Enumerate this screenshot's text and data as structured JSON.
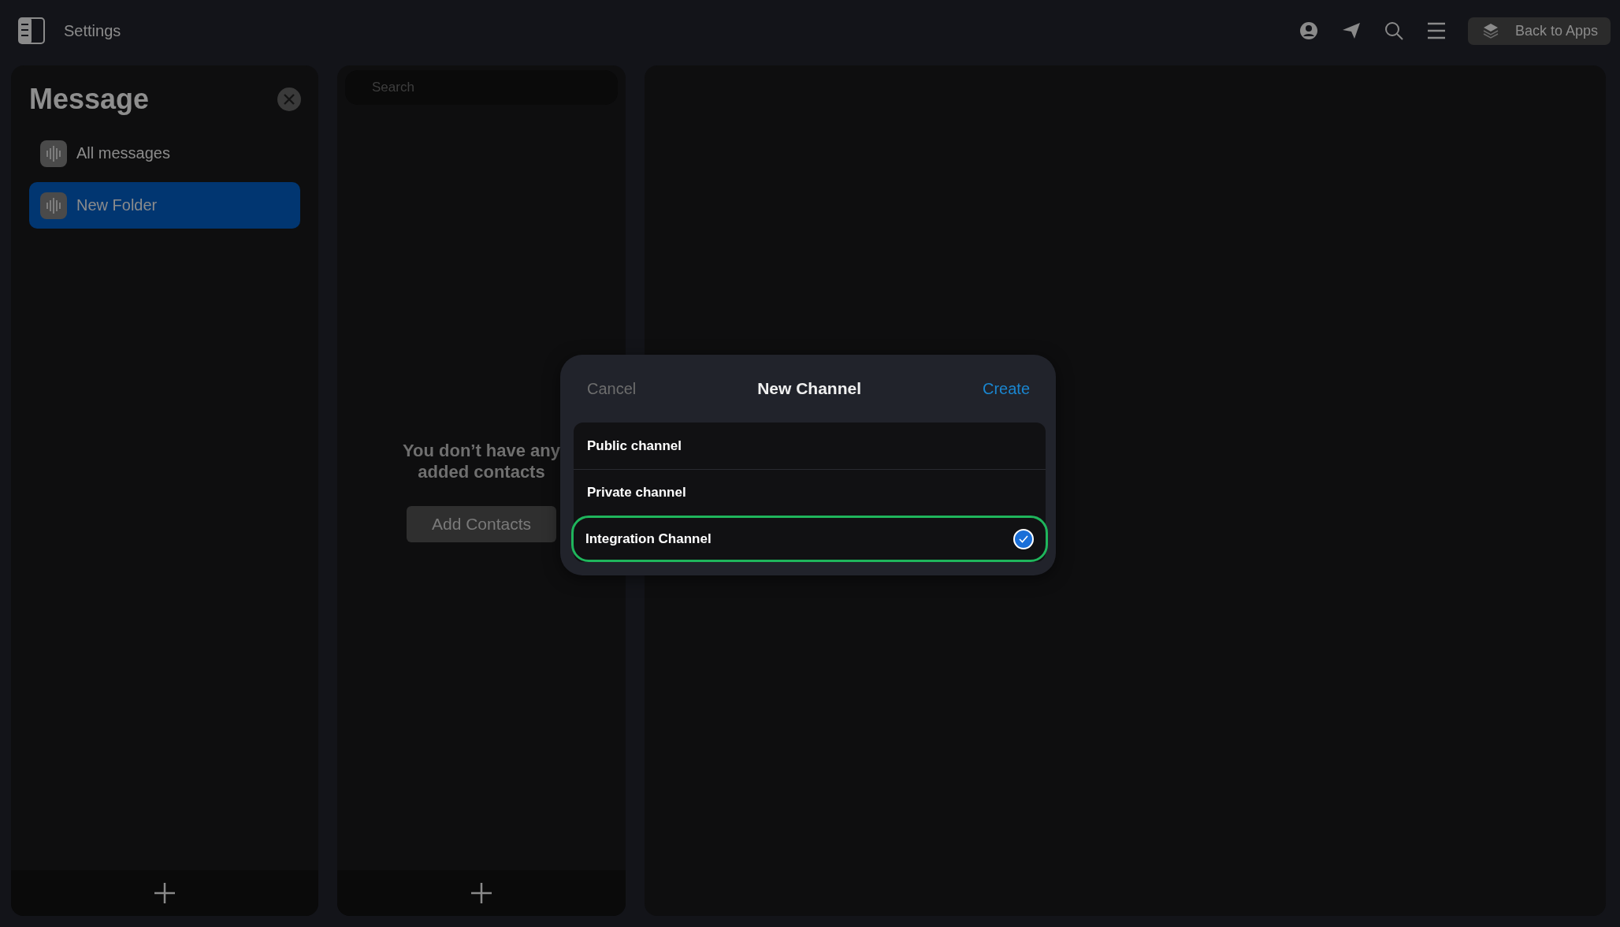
{
  "topbar": {
    "title": "Settings",
    "back_button": "Back to Apps"
  },
  "folders": {
    "title": "Message",
    "items": [
      {
        "label": "All messages",
        "selected": false
      },
      {
        "label": "New Folder",
        "selected": true
      }
    ]
  },
  "contacts": {
    "search": {
      "placeholder": "Search"
    },
    "empty_message": "You don’t have any added contacts",
    "add_button": "Add Contacts"
  },
  "dialog": {
    "cancel": "Cancel",
    "title": "New Channel",
    "create": "Create",
    "options": [
      {
        "label": "Public channel",
        "selected": false
      },
      {
        "label": "Private channel",
        "selected": false
      },
      {
        "label": "Integration Channel",
        "selected": true
      }
    ]
  }
}
